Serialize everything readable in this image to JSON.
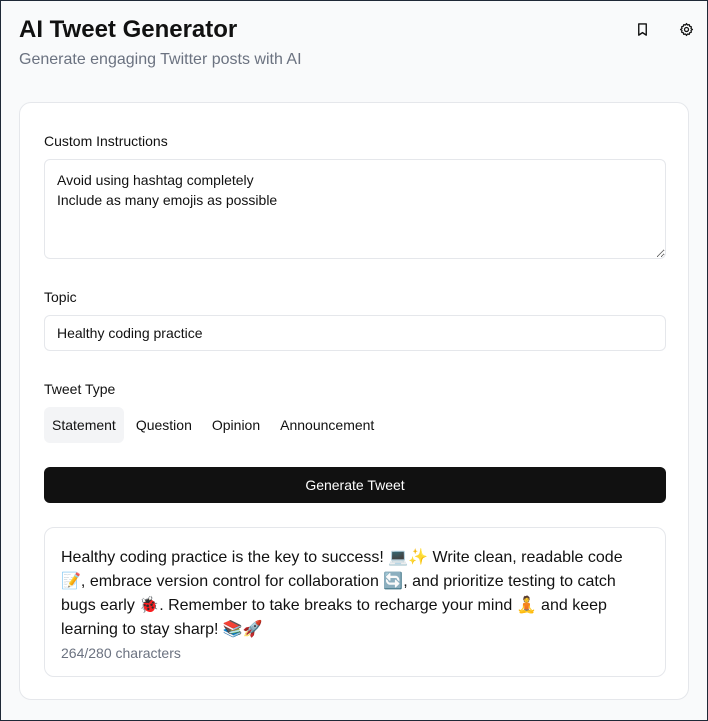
{
  "header": {
    "title": "AI Tweet Generator",
    "subtitle": "Generate engaging Twitter posts with AI",
    "icons": [
      "bookmark-icon",
      "settings-icon"
    ]
  },
  "form": {
    "custom_instructions_label": "Custom Instructions",
    "custom_instructions_value": "Avoid using hashtag completely\nInclude as many emojis as possible",
    "topic_label": "Topic",
    "topic_value": "Healthy coding practice",
    "tweet_type_label": "Tweet Type",
    "tweet_types": [
      "Statement",
      "Question",
      "Opinion",
      "Announcement"
    ],
    "selected_tweet_type": "Statement",
    "generate_label": "Generate Tweet"
  },
  "result": {
    "tweet": "Healthy coding practice is the key to success! 💻✨ Write clean, readable code 📝, embrace version control for collaboration 🔄, and prioritize testing to catch bugs early 🐞. Remember to take breaks to recharge your mind 🧘 and keep learning to stay sharp! 📚🚀",
    "char_count": "264/280 characters"
  },
  "colors": {
    "primary_button": "#111111",
    "muted_text": "#6b7280",
    "border": "#e5e7eb",
    "selected_bg": "#f3f4f6"
  }
}
